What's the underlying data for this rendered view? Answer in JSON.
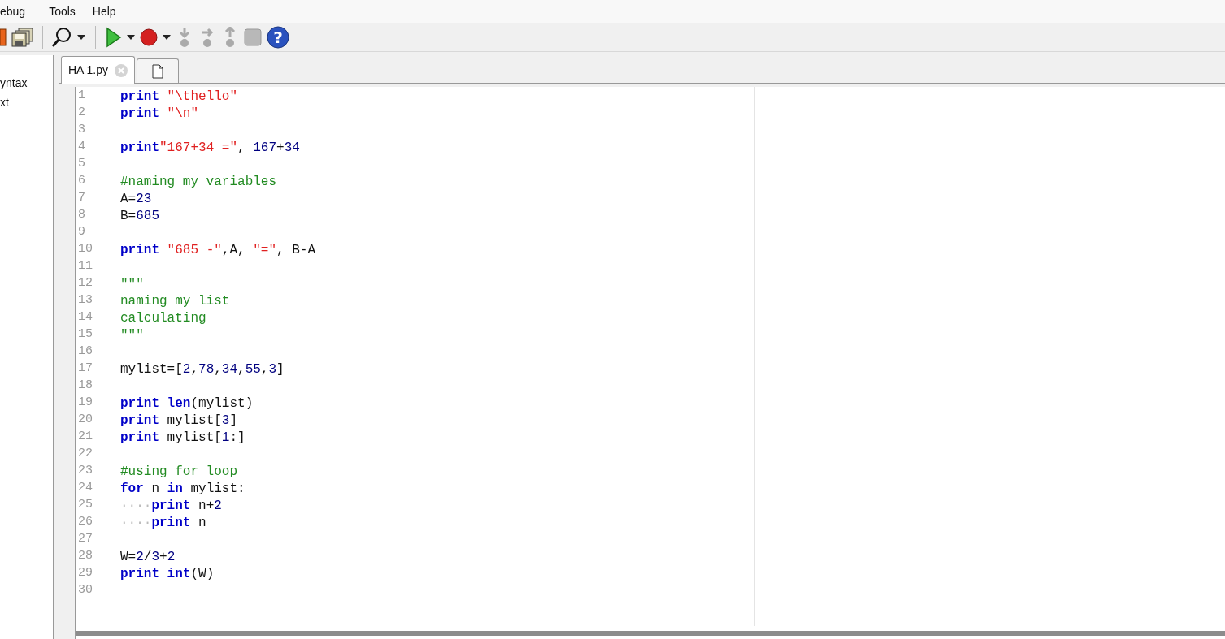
{
  "menu": [
    "ebug",
    "Tools",
    "Help"
  ],
  "toolbar": {
    "help_glyph": "?"
  },
  "sidebar": {
    "items": [
      "yntax",
      "xt"
    ]
  },
  "tabs": [
    {
      "label": "HA 1.py",
      "kind": "file",
      "selected": true
    },
    {
      "kind": "new",
      "selected": false
    }
  ],
  "editor": {
    "lines": [
      {
        "number": "1",
        "tokens": [
          {
            "kind": "kw",
            "text": "print"
          },
          {
            "kind": "str",
            "text": " \"\\thello\""
          }
        ]
      },
      {
        "number": "2",
        "tokens": [
          {
            "kind": "kw",
            "text": "print"
          },
          {
            "kind": "str",
            "text": " \"\\n\""
          }
        ]
      },
      {
        "number": "3"
      },
      {
        "number": "4",
        "tokens": [
          {
            "kind": "kw",
            "text": "print"
          },
          {
            "kind": "str",
            "text": "\"167+34 =\""
          },
          {
            "kind": "plain",
            "text": ", "
          },
          {
            "kind": "num",
            "text": "167"
          },
          {
            "kind": "plain",
            "text": "+"
          },
          {
            "kind": "num",
            "text": "34"
          }
        ]
      },
      {
        "number": "5"
      },
      {
        "number": "6",
        "tokens": [
          {
            "kind": "com",
            "text": "#naming my variables"
          }
        ]
      },
      {
        "number": "7",
        "tokens": [
          {
            "kind": "plain",
            "text": "A="
          },
          {
            "kind": "num",
            "text": "23"
          }
        ]
      },
      {
        "number": "8",
        "tokens": [
          {
            "kind": "plain",
            "text": "B="
          },
          {
            "kind": "num",
            "text": "685"
          }
        ]
      },
      {
        "number": "9"
      },
      {
        "number": "10",
        "tokens": [
          {
            "kind": "kw",
            "text": "print"
          },
          {
            "kind": "str",
            "text": " \"685 -\""
          },
          {
            "kind": "plain",
            "text": ",A, "
          },
          {
            "kind": "str",
            "text": "\"=\""
          },
          {
            "kind": "plain",
            "text": ", B-A"
          }
        ]
      },
      {
        "number": "11"
      },
      {
        "number": "12",
        "tokens": [
          {
            "kind": "com",
            "text": "\"\"\""
          }
        ]
      },
      {
        "number": "13",
        "tokens": [
          {
            "kind": "com",
            "text": "naming my list"
          }
        ]
      },
      {
        "number": "14",
        "tokens": [
          {
            "kind": "com",
            "text": "calculating"
          }
        ]
      },
      {
        "number": "15",
        "tokens": [
          {
            "kind": "com",
            "text": "\"\"\""
          }
        ]
      },
      {
        "number": "16"
      },
      {
        "number": "17",
        "tokens": [
          {
            "kind": "plain",
            "text": "mylist=["
          },
          {
            "kind": "num",
            "text": "2"
          },
          {
            "kind": "plain",
            "text": ","
          },
          {
            "kind": "num",
            "text": "78"
          },
          {
            "kind": "plain",
            "text": ","
          },
          {
            "kind": "num",
            "text": "34"
          },
          {
            "kind": "plain",
            "text": ","
          },
          {
            "kind": "num",
            "text": "55"
          },
          {
            "kind": "plain",
            "text": ","
          },
          {
            "kind": "num",
            "text": "3"
          },
          {
            "kind": "plain",
            "text": "]"
          }
        ]
      },
      {
        "number": "18"
      },
      {
        "number": "19",
        "tokens": [
          {
            "kind": "kw",
            "text": "print len"
          },
          {
            "kind": "plain",
            "text": "(mylist)"
          }
        ]
      },
      {
        "number": "20",
        "tokens": [
          {
            "kind": "kw",
            "text": "print"
          },
          {
            "kind": "plain",
            "text": " mylist["
          },
          {
            "kind": "num",
            "text": "3"
          },
          {
            "kind": "plain",
            "text": "]"
          }
        ]
      },
      {
        "number": "21",
        "tokens": [
          {
            "kind": "kw",
            "text": "print"
          },
          {
            "kind": "plain",
            "text": " mylist["
          },
          {
            "kind": "num",
            "text": "1"
          },
          {
            "kind": "plain",
            "text": ":]"
          }
        ]
      },
      {
        "number": "22"
      },
      {
        "number": "23",
        "tokens": [
          {
            "kind": "com",
            "text": "#using for loop"
          }
        ]
      },
      {
        "number": "24",
        "tokens": [
          {
            "kind": "kw",
            "text": "for"
          },
          {
            "kind": "plain",
            "text": " n "
          },
          {
            "kind": "kw",
            "text": "in"
          },
          {
            "kind": "plain",
            "text": " mylist:"
          }
        ]
      },
      {
        "number": "25",
        "tokens": [
          {
            "kind": "ws",
            "text": "····"
          },
          {
            "kind": "kw",
            "text": "print"
          },
          {
            "kind": "plain",
            "text": " n+"
          },
          {
            "kind": "num",
            "text": "2"
          }
        ]
      },
      {
        "number": "26",
        "tokens": [
          {
            "kind": "ws",
            "text": "····"
          },
          {
            "kind": "kw",
            "text": "print"
          },
          {
            "kind": "plain",
            "text": " n"
          }
        ]
      },
      {
        "number": "27"
      },
      {
        "number": "28",
        "tokens": [
          {
            "kind": "plain",
            "text": "W="
          },
          {
            "kind": "num",
            "text": "2"
          },
          {
            "kind": "plain",
            "text": "/"
          },
          {
            "kind": "num",
            "text": "3"
          },
          {
            "kind": "plain",
            "text": "+"
          },
          {
            "kind": "num",
            "text": "2"
          }
        ]
      },
      {
        "number": "29",
        "tokens": [
          {
            "kind": "kw",
            "text": "print int"
          },
          {
            "kind": "plain",
            "text": "(W)"
          }
        ]
      },
      {
        "number": "30"
      }
    ]
  }
}
